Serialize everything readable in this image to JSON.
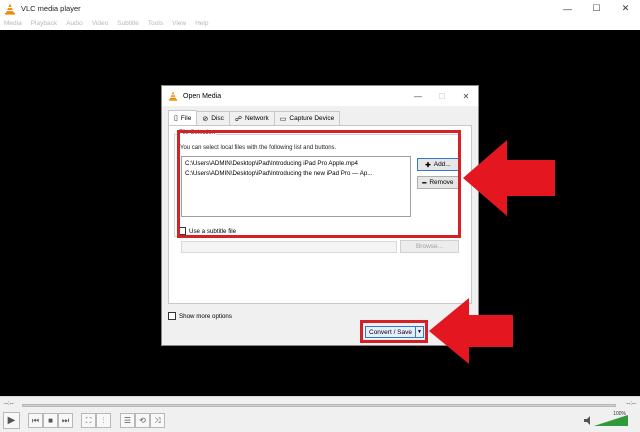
{
  "app": {
    "title": "VLC media player",
    "menu": [
      "Media",
      "Playback",
      "Audio",
      "Video",
      "Subtitle",
      "Tools",
      "View",
      "Help"
    ]
  },
  "dialog": {
    "title": "Open Media",
    "tabs": [
      {
        "label": "File",
        "icon": "file-icon"
      },
      {
        "label": "Disc",
        "icon": "disc-icon"
      },
      {
        "label": "Network",
        "icon": "network-icon"
      },
      {
        "label": "Capture Device",
        "icon": "capture-device-icon"
      }
    ],
    "file_selection": {
      "group_label": "File Selection",
      "description": "You can select local files with the following list and buttons.",
      "files": [
        "C:\\Users\\ADMIN\\Desktop\\iPad\\Introducing iPad Pro Apple.mp4",
        "C:\\Users\\ADMIN\\Desktop\\iPad\\Introducing the new iPad Pro — Ap..."
      ],
      "add_label": "Add...",
      "remove_label": "Remove"
    },
    "subtitle": {
      "checkbox_label": "Use a subtitle file",
      "checked": false,
      "browse_label": "Browse..."
    },
    "show_more_options": {
      "label": "Show more options",
      "checked": false
    },
    "convert_save_label": "Convert / Save"
  },
  "player": {
    "time_elapsed": "--:--",
    "time_total": "--:--",
    "volume": "100%"
  },
  "annotations": {
    "color": "#d42027"
  }
}
